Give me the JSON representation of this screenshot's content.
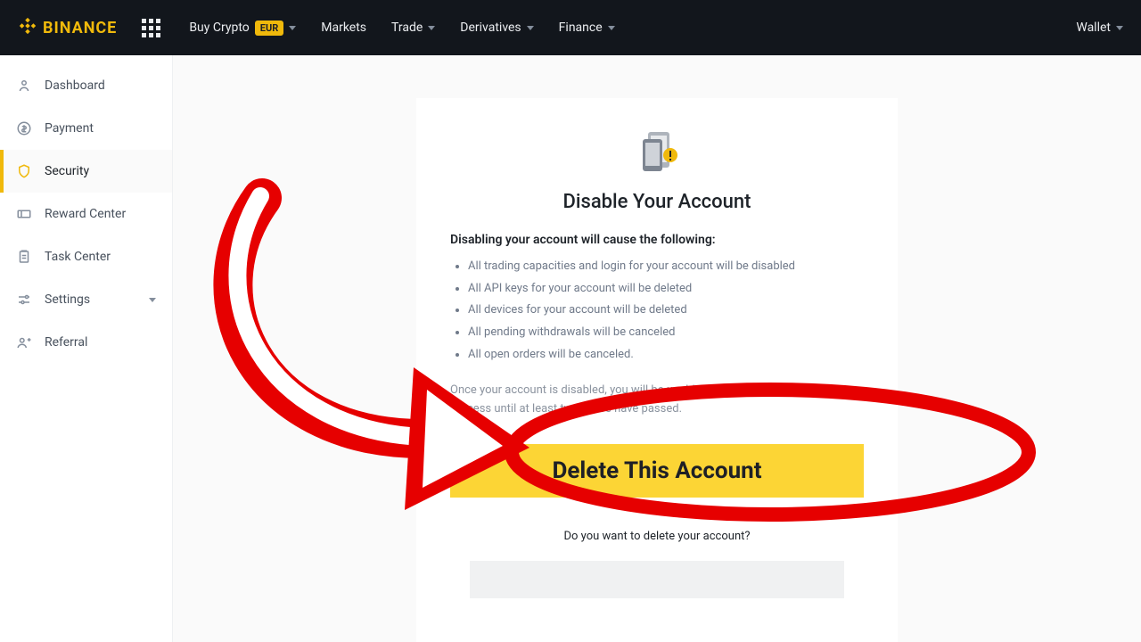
{
  "brand": {
    "name": "BINANCE"
  },
  "nav": {
    "buy_crypto": "Buy Crypto",
    "eur_badge": "EUR",
    "markets": "Markets",
    "trade": "Trade",
    "derivatives": "Derivatives",
    "finance": "Finance",
    "wallet": "Wallet"
  },
  "sidebar": {
    "items": [
      {
        "label": "Dashboard"
      },
      {
        "label": "Payment"
      },
      {
        "label": "Security"
      },
      {
        "label": "Reward Center"
      },
      {
        "label": "Task Center"
      },
      {
        "label": "Settings"
      },
      {
        "label": "Referral"
      }
    ]
  },
  "card": {
    "title": "Disable Your Account",
    "lead": "Disabling your account will cause the following:",
    "bullets": [
      "All trading capacities and login for your account will be disabled",
      "All API keys for your account will be deleted",
      "All devices for your account will be deleted",
      "All pending withdrawals will be canceled",
      "All open orders will be canceled."
    ],
    "note": "Once your account is disabled, you will be unable to begin the reactivation process until at least two hours have passed.",
    "cta": "Delete This Account",
    "after_q": "Do you want to delete your account?"
  },
  "highlight": {
    "color": "#e60000"
  }
}
